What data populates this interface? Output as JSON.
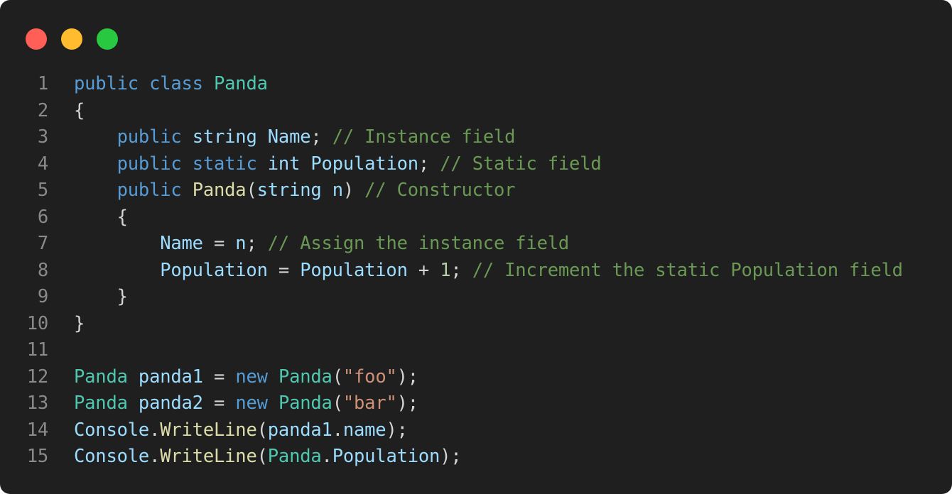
{
  "window": {
    "controls": [
      {
        "name": "close-control",
        "color": "#ff5f57"
      },
      {
        "name": "minimize-control",
        "color": "#febc2e"
      },
      {
        "name": "maximize-control",
        "color": "#28c840"
      }
    ]
  },
  "colors": {
    "background": "#1f1f1f",
    "keyword": "#569cd6",
    "type": "#4ec9b0",
    "identifier": "#9cdcfe",
    "method": "#dcdcaa",
    "string": "#ce9178",
    "number": "#b5cea8",
    "comment": "#6a9955",
    "punctuation": "#d4d4d4",
    "line_number": "#8a8a8a"
  },
  "code": {
    "language": "C#",
    "lines": [
      {
        "n": "1",
        "tokens": [
          {
            "t": "public",
            "k": "keyword"
          },
          {
            "t": " ",
            "k": "punctuation"
          },
          {
            "t": "class",
            "k": "keyword"
          },
          {
            "t": " ",
            "k": "punctuation"
          },
          {
            "t": "Panda",
            "k": "type"
          }
        ]
      },
      {
        "n": "2",
        "tokens": [
          {
            "t": "{",
            "k": "punctuation"
          }
        ]
      },
      {
        "n": "3",
        "tokens": [
          {
            "t": "    ",
            "k": "punctuation"
          },
          {
            "t": "public",
            "k": "keyword"
          },
          {
            "t": " ",
            "k": "punctuation"
          },
          {
            "t": "string",
            "k": "identifier"
          },
          {
            "t": " ",
            "k": "punctuation"
          },
          {
            "t": "Name",
            "k": "identifier"
          },
          {
            "t": "; ",
            "k": "punctuation"
          },
          {
            "t": "// Instance field",
            "k": "comment"
          }
        ]
      },
      {
        "n": "4",
        "tokens": [
          {
            "t": "    ",
            "k": "punctuation"
          },
          {
            "t": "public",
            "k": "keyword"
          },
          {
            "t": " ",
            "k": "punctuation"
          },
          {
            "t": "static",
            "k": "keyword"
          },
          {
            "t": " ",
            "k": "punctuation"
          },
          {
            "t": "int",
            "k": "identifier"
          },
          {
            "t": " ",
            "k": "punctuation"
          },
          {
            "t": "Population",
            "k": "identifier"
          },
          {
            "t": "; ",
            "k": "punctuation"
          },
          {
            "t": "// Static field",
            "k": "comment"
          }
        ]
      },
      {
        "n": "5",
        "tokens": [
          {
            "t": "    ",
            "k": "punctuation"
          },
          {
            "t": "public",
            "k": "keyword"
          },
          {
            "t": " ",
            "k": "punctuation"
          },
          {
            "t": "Panda",
            "k": "method"
          },
          {
            "t": "(",
            "k": "punctuation"
          },
          {
            "t": "string",
            "k": "identifier"
          },
          {
            "t": " ",
            "k": "punctuation"
          },
          {
            "t": "n",
            "k": "identifier"
          },
          {
            "t": ") ",
            "k": "punctuation"
          },
          {
            "t": "// Constructor",
            "k": "comment"
          }
        ]
      },
      {
        "n": "6",
        "tokens": [
          {
            "t": "    {",
            "k": "punctuation"
          }
        ]
      },
      {
        "n": "7",
        "tokens": [
          {
            "t": "        ",
            "k": "punctuation"
          },
          {
            "t": "Name",
            "k": "identifier"
          },
          {
            "t": " = ",
            "k": "punctuation"
          },
          {
            "t": "n",
            "k": "identifier"
          },
          {
            "t": "; ",
            "k": "punctuation"
          },
          {
            "t": "// Assign the instance field",
            "k": "comment"
          }
        ]
      },
      {
        "n": "8",
        "tokens": [
          {
            "t": "        ",
            "k": "punctuation"
          },
          {
            "t": "Population",
            "k": "identifier"
          },
          {
            "t": " = ",
            "k": "punctuation"
          },
          {
            "t": "Population",
            "k": "identifier"
          },
          {
            "t": " + ",
            "k": "punctuation"
          },
          {
            "t": "1",
            "k": "number"
          },
          {
            "t": "; ",
            "k": "punctuation"
          },
          {
            "t": "// Increment the static Population field",
            "k": "comment"
          }
        ]
      },
      {
        "n": "9",
        "tokens": [
          {
            "t": "    }",
            "k": "punctuation"
          }
        ]
      },
      {
        "n": "10",
        "tokens": [
          {
            "t": "}",
            "k": "punctuation"
          }
        ]
      },
      {
        "n": "11",
        "tokens": []
      },
      {
        "n": "12",
        "tokens": [
          {
            "t": "Panda",
            "k": "type"
          },
          {
            "t": " ",
            "k": "punctuation"
          },
          {
            "t": "panda1",
            "k": "identifier"
          },
          {
            "t": " = ",
            "k": "punctuation"
          },
          {
            "t": "new",
            "k": "keyword"
          },
          {
            "t": " ",
            "k": "punctuation"
          },
          {
            "t": "Panda",
            "k": "type"
          },
          {
            "t": "(",
            "k": "punctuation"
          },
          {
            "t": "\"foo\"",
            "k": "string"
          },
          {
            "t": ");",
            "k": "punctuation"
          }
        ]
      },
      {
        "n": "13",
        "tokens": [
          {
            "t": "Panda",
            "k": "type"
          },
          {
            "t": " ",
            "k": "punctuation"
          },
          {
            "t": "panda2",
            "k": "identifier"
          },
          {
            "t": " = ",
            "k": "punctuation"
          },
          {
            "t": "new",
            "k": "keyword"
          },
          {
            "t": " ",
            "k": "punctuation"
          },
          {
            "t": "Panda",
            "k": "type"
          },
          {
            "t": "(",
            "k": "punctuation"
          },
          {
            "t": "\"bar\"",
            "k": "string"
          },
          {
            "t": ");",
            "k": "punctuation"
          }
        ]
      },
      {
        "n": "14",
        "tokens": [
          {
            "t": "Console",
            "k": "identifier"
          },
          {
            "t": ".",
            "k": "punctuation"
          },
          {
            "t": "WriteLine",
            "k": "method"
          },
          {
            "t": "(",
            "k": "punctuation"
          },
          {
            "t": "panda1",
            "k": "identifier"
          },
          {
            "t": ".",
            "k": "punctuation"
          },
          {
            "t": "name",
            "k": "identifier"
          },
          {
            "t": ");",
            "k": "punctuation"
          }
        ]
      },
      {
        "n": "15",
        "tokens": [
          {
            "t": "Console",
            "k": "identifier"
          },
          {
            "t": ".",
            "k": "punctuation"
          },
          {
            "t": "WriteLine",
            "k": "method"
          },
          {
            "t": "(",
            "k": "punctuation"
          },
          {
            "t": "Panda",
            "k": "type"
          },
          {
            "t": ".",
            "k": "punctuation"
          },
          {
            "t": "Population",
            "k": "identifier"
          },
          {
            "t": ");",
            "k": "punctuation"
          }
        ]
      }
    ]
  }
}
